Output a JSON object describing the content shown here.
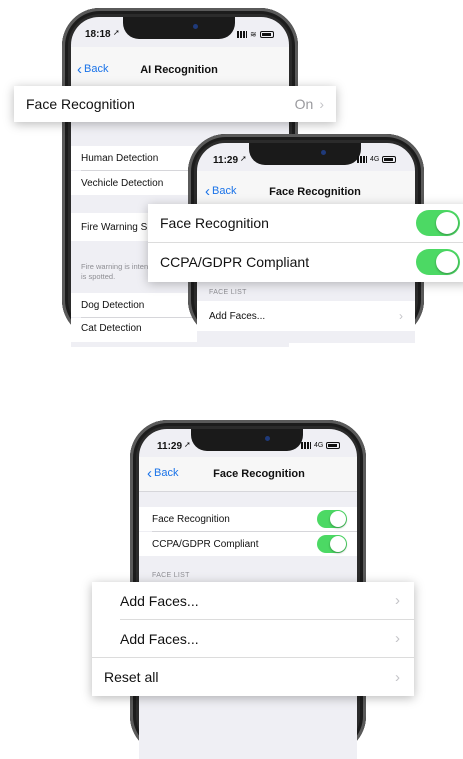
{
  "top": {
    "phone_a": {
      "time": "18:18",
      "nav": {
        "back": "Back",
        "title": "AI Recognition"
      },
      "rows": [
        "Human Detection",
        "Vechicle Detection",
        "Fire Warning Su",
        "Dog Detection",
        "Cat Detection"
      ],
      "fire_note": "Fire warning is inten\nis spotted."
    },
    "popout": {
      "label": "Face Recognition",
      "value": "On"
    },
    "phone_b": {
      "time": "11:29",
      "network": "4G",
      "nav": {
        "back": "Back",
        "title": "Face Recognition"
      },
      "section": "FACE LIST",
      "row": "Add Faces..."
    },
    "toggle_card": {
      "rows": [
        {
          "label": "Face Recognition",
          "on": true
        },
        {
          "label": "CCPA/GDPR Compliant",
          "on": true
        }
      ]
    }
  },
  "bottom": {
    "phone": {
      "time": "11:29",
      "network": "4G",
      "nav": {
        "back": "Back",
        "title": "Face Recognition"
      },
      "rows": [
        {
          "label": "Face Recognition",
          "on": true
        },
        {
          "label": "CCPA/GDPR Compliant",
          "on": true
        }
      ],
      "section": "FACE LIST"
    },
    "list_card": {
      "rows": [
        "Add Faces...",
        "Add Faces...",
        "Reset all"
      ]
    }
  },
  "colors": {
    "accent": "#1a73e8",
    "toggle_on": "#4cd964",
    "background": "#efeff4"
  }
}
